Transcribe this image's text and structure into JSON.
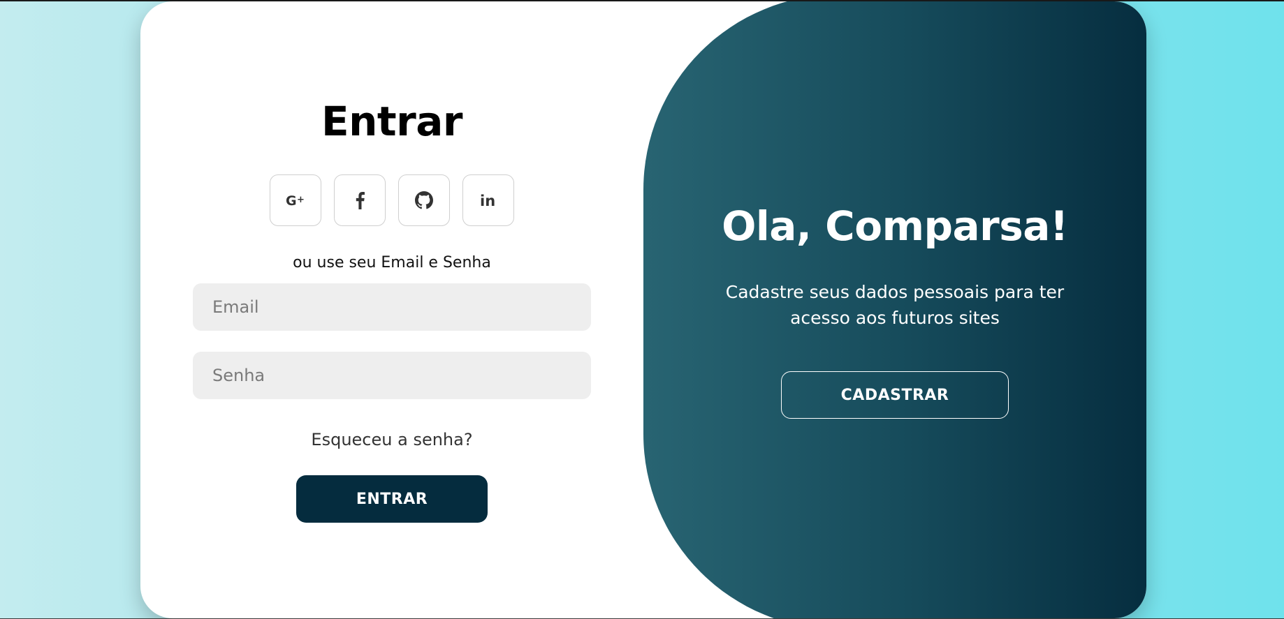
{
  "colors": {
    "primary_dark": "#052c3e",
    "panel_gradient_start": "#286472",
    "panel_gradient_end": "#042a3c",
    "background_start": "#c3ecef",
    "background_end": "#6fe2ec",
    "input_bg": "#eeeeee"
  },
  "signin": {
    "title": "Entrar",
    "social": [
      {
        "icon": "google-plus-icon",
        "glyph": "G+"
      },
      {
        "icon": "facebook-icon",
        "glyph": "f"
      },
      {
        "icon": "github-icon",
        "glyph": "github"
      },
      {
        "icon": "linkedin-icon",
        "glyph": "in"
      }
    ],
    "alt_text": "ou use seu Email e Senha",
    "email_placeholder": "Email",
    "password_placeholder": "Senha",
    "forgot_label": "Esqueceu a senha?",
    "button_label": "ENTRAR"
  },
  "welcome": {
    "title": "Ola, Comparsa!",
    "text": "Cadastre seus dados pessoais para ter acesso aos futuros sites",
    "button_label": "CADASTRAR"
  }
}
